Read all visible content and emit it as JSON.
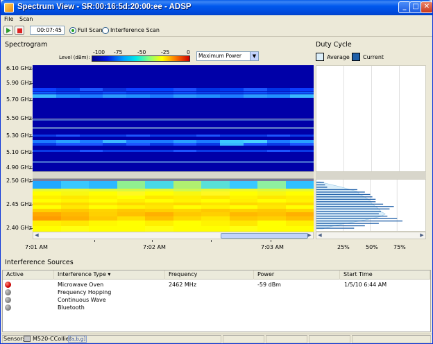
{
  "window": {
    "title": "Spectrum View - SR:00:16:5d:20:00:ee - ADSP"
  },
  "menu": [
    "File",
    "Scan"
  ],
  "toolbar": {
    "timer": "00:07:45",
    "full_scan": "Full Scan",
    "interference_scan": "Interference Scan",
    "selected_mode": "Full Scan"
  },
  "spectrogram": {
    "title": "Spectrogram",
    "level_label": "Level (dBm):",
    "level_ticks": [
      "-100",
      "-75",
      "-50",
      "-25",
      "0"
    ],
    "display_mode": "Maximum Power",
    "upper_freq_labels": [
      "6.10 GHz",
      "5.90 GHz",
      "5.70 GHz",
      "5.50 GHz",
      "5.30 GHz",
      "5.10 GHz",
      "4.90 GHz"
    ],
    "lower_freq_labels": [
      "2.50 GHz",
      "2.45 GHz",
      "2.40 GHz"
    ],
    "time_labels": [
      "7:01 AM",
      "7:02 AM",
      "7:03 AM"
    ]
  },
  "duty_cycle": {
    "title": "Duty Cycle",
    "legend": [
      "Average",
      "Current"
    ],
    "average_color": "#dceffa",
    "current_color": "#1f5fa8",
    "axis_labels": [
      "25%",
      "50%",
      "75%"
    ],
    "current_bars_percent": [
      7,
      8,
      10,
      38,
      45,
      50,
      52,
      55,
      55,
      62,
      72,
      68,
      60,
      58,
      66,
      75,
      80,
      58,
      45,
      35
    ],
    "average_profile_percent": [
      3,
      12,
      22,
      30,
      38,
      40,
      44,
      48,
      50,
      52,
      55,
      58,
      60,
      64,
      60,
      50,
      38,
      25,
      14,
      6
    ]
  },
  "interference": {
    "title": "Interference Sources",
    "columns": [
      "Active",
      "Interference Type",
      "Frequency",
      "Power",
      "Start Time"
    ],
    "rows": [
      {
        "active": true,
        "type": "Microwave Oven",
        "frequency": "2462 MHz",
        "power": "-59 dBm",
        "start_time": "1/5/10 6:44 AM"
      },
      {
        "active": false,
        "type": "Frequency Hopping",
        "frequency": "",
        "power": "",
        "start_time": ""
      },
      {
        "active": false,
        "type": "Continuous Wave",
        "frequency": "",
        "power": "",
        "start_time": ""
      },
      {
        "active": false,
        "type": "Bluetooth",
        "frequency": "",
        "power": "",
        "start_time": ""
      }
    ]
  },
  "status": {
    "label": "Sensor:",
    "sensor": "M520-CCollier",
    "band": "[a,b,g]"
  }
}
